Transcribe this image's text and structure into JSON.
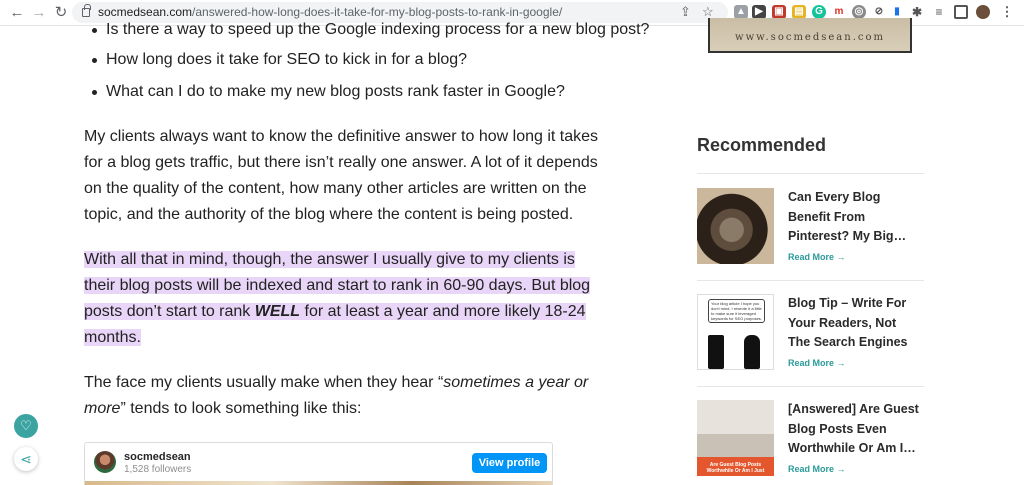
{
  "browser": {
    "url_host": "socmedsean.com",
    "url_path": "/answered-how-long-does-it-take-for-my-blog-posts-to-rank-in-google/"
  },
  "article": {
    "bullets": [
      "Is there a way to speed up the Google indexing process for a new blog post?",
      "How long does it take for SEO to kick in for a blog?",
      "What can I do to make my new blog posts rank faster in Google?"
    ],
    "para1_lines": [
      "My clients always want to know the definitive answer to how long it takes",
      "for a blog gets traffic, but there isn’t really one answer. A lot of it depends",
      "on the quality of the content, how many other articles are written on the",
      "topic, and the authority of the blog where the content is being posted."
    ],
    "para2_lines": [
      "With all that in mind, though, the answer I usually give to my clients is",
      "their blog posts will be indexed and start to rank in 60-90 days. But blog"
    ],
    "para2_line3_before": "posts don’t start to rank ",
    "para2_line3_bold": "WELL",
    "para2_line3_after": " for at least a year and more likely 18-24",
    "para2_line4": "months.",
    "para3_line1_before": "The face my clients usually make when they hear “",
    "para3_line1_italic": "sometimes a year or",
    "para3_line2_italic": "more",
    "para3_line2_after": "” tends to look something like this:",
    "highlight_color": "#e8d5f7"
  },
  "embed": {
    "username": "socmedsean",
    "followers": "1,528 followers",
    "button_label": "View profile",
    "button_color": "#0095f6"
  },
  "sidebar": {
    "banner_text": "www.socmedsean.com",
    "recommended_title": "Recommended",
    "items": [
      {
        "title_lines": [
          "Can Every Blog",
          "Benefit From",
          "Pinterest? My Big…"
        ],
        "read_more": "Read More →"
      },
      {
        "title_lines": [
          "Blog Tip – Write For",
          "Your Readers, Not",
          "The Search Engines"
        ],
        "read_more": "Read More →",
        "thumb_bubble": "Your blog article I hope you don't mind. I rewrote it a little to make sure it leveraged keywords for SEO purposes."
      },
      {
        "title_lines": [
          "[Answered] Are Guest",
          "Blog Posts Even",
          "Worthwhile Or Am I…"
        ],
        "read_more": "Read More →",
        "thumb_caption_lines": [
          "Are Guest Blog Posts",
          "Worthwhile Or Am I Just"
        ]
      }
    ],
    "accent_color": "#2b9a9a"
  },
  "icons": [
    "back-arrow-icon",
    "forward-arrow-icon",
    "reload-icon",
    "lock-icon",
    "share-icon",
    "bookmark-star-icon",
    "puzzle-extensions-icon",
    "sidebar-icon",
    "kebab-menu-icon",
    "heart-icon",
    "share-network-icon"
  ]
}
